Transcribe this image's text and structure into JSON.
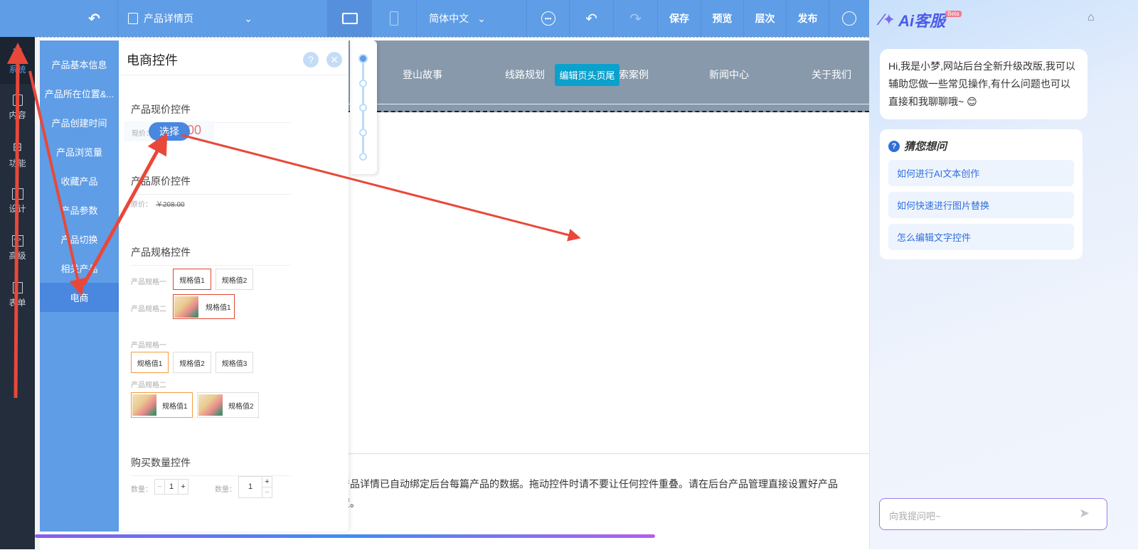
{
  "topbar": {
    "page_name": "产品详情页",
    "language": "简体中文",
    "save": "保存",
    "preview": "预览",
    "layers": "层次",
    "publish": "发布"
  },
  "leftnav": [
    "系统",
    "内容",
    "功能",
    "设计",
    "高级",
    "表单"
  ],
  "subnav": [
    "产品基本信息",
    "产品所在位置&...",
    "产品创建时间",
    "产品浏览量",
    "收藏产品",
    "产品参数",
    "产品切换",
    "相关产品",
    "电商"
  ],
  "panel": {
    "title": "电商控件",
    "current_price": {
      "title": "产品现价控件",
      "label": "现价：",
      "value": "00",
      "select_button": "选择"
    },
    "original_price": {
      "title": "产品原价控件",
      "label": "原价：",
      "value": "￥208.00"
    },
    "spec": {
      "title": "产品规格控件",
      "spec1": "产品规格一",
      "spec2": "产品规格二",
      "v1": "规格值1",
      "v2": "规格值2",
      "v3": "规格值3"
    },
    "quantity": {
      "title": "购买数量控件",
      "label": "数量：",
      "value": "1",
      "minus": "−",
      "plus": "+"
    }
  },
  "canvas": {
    "nav": [
      "登山故事",
      "线路规划",
      "索案例",
      "新闻中心",
      "关于我们"
    ],
    "edit_header_button": "编辑页头页尾",
    "notice_line1": "产品详情已自动绑定后台每篇产品的数据。拖动控件时请不要让任何控件重叠。请在后台产品管理直接设置好产品",
    "notice_line2": "置。"
  },
  "ai": {
    "title": "Ai客服",
    "beta": "Beta",
    "greeting": "Hi,我是小梦,网站后台全新升级改版,我可以辅助您做一些常见操作,有什么问题也可以直接和我聊聊哦~ 😊",
    "guess_title": "猜您想问",
    "questions": [
      "如何进行AI文本创作",
      "如何快速进行图片替换",
      "怎么编辑文字控件"
    ],
    "input_placeholder": "向我提问吧~"
  }
}
